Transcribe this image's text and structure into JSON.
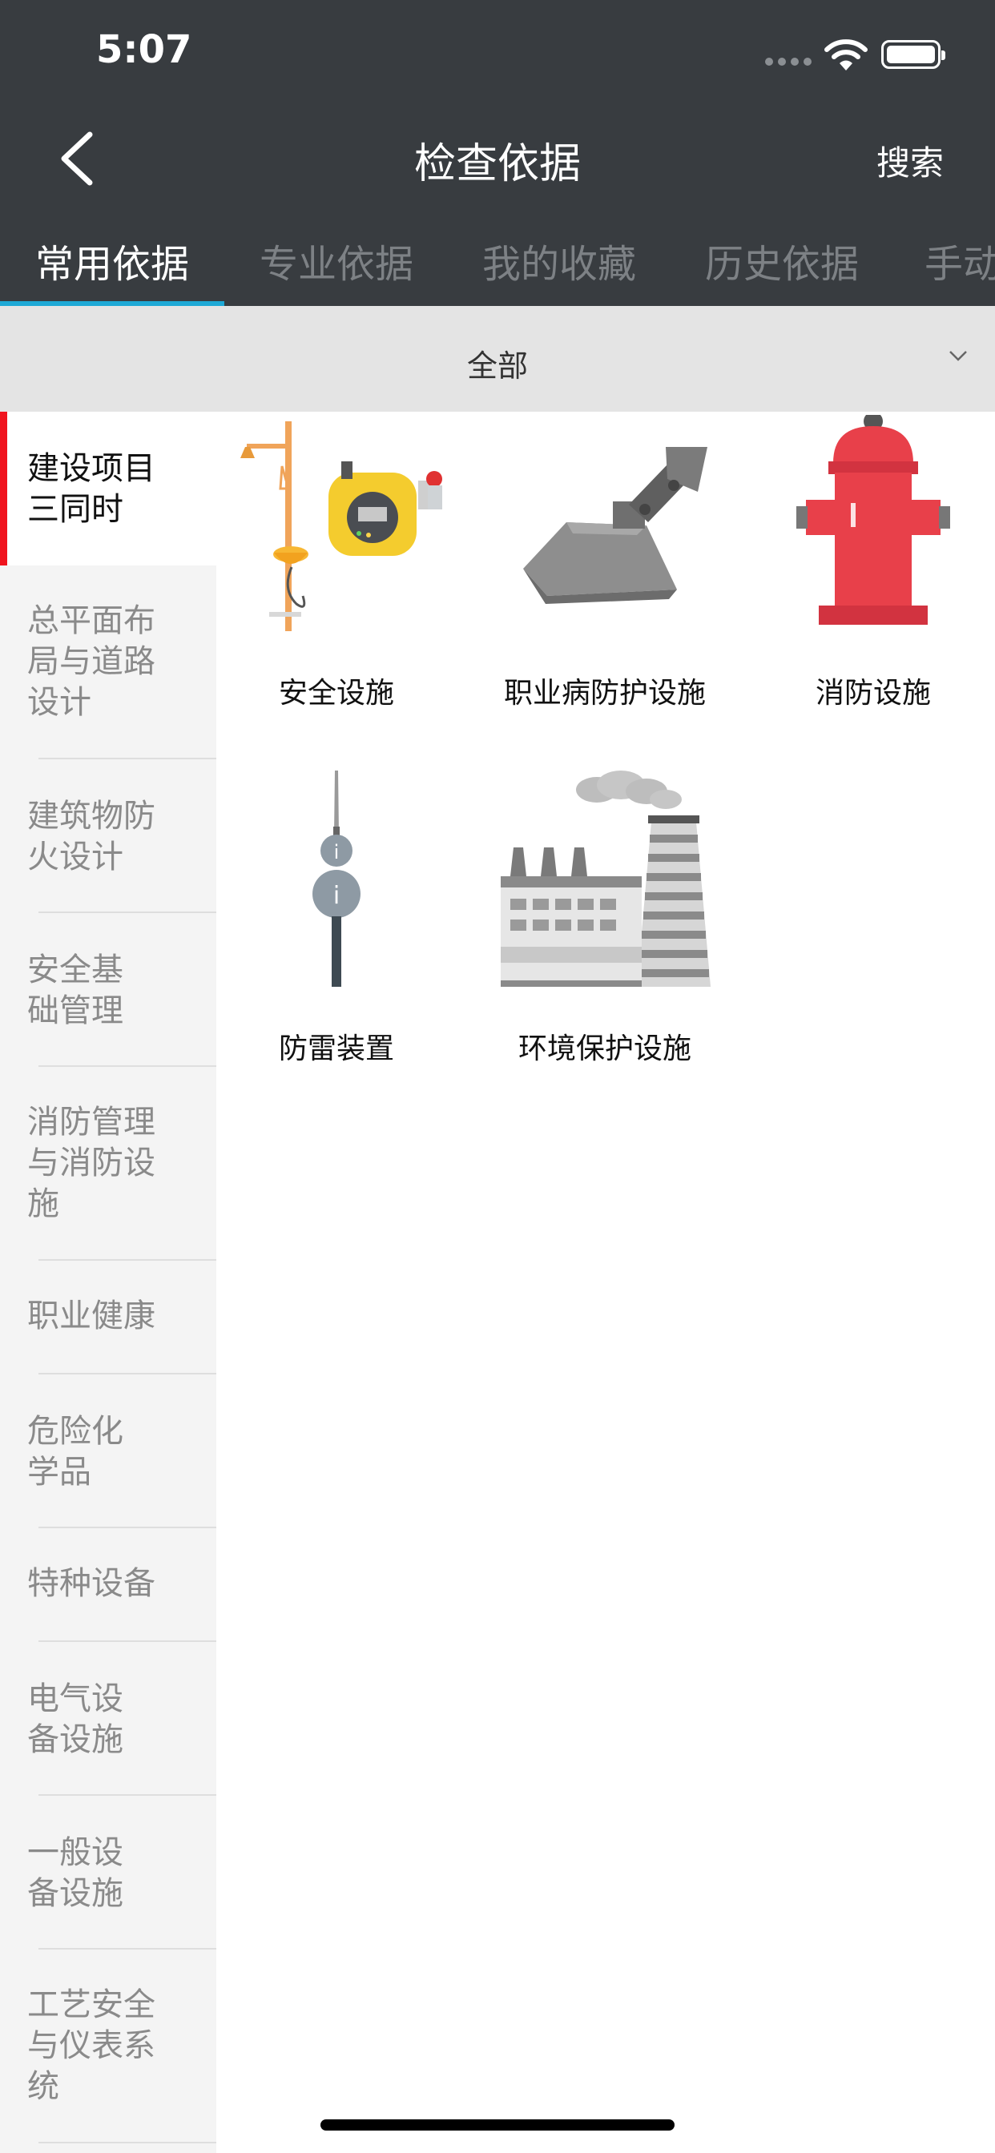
{
  "status_bar": {
    "time": "5:07"
  },
  "nav": {
    "title": "检查依据",
    "search_label": "搜索"
  },
  "tabs": [
    {
      "label": "常用依据",
      "active": true
    },
    {
      "label": "专业依据",
      "active": false
    },
    {
      "label": "我的收藏",
      "active": false
    },
    {
      "label": "历史依据",
      "active": false
    },
    {
      "label": "手动",
      "active": false
    }
  ],
  "filter": {
    "selected": "全部"
  },
  "sidebar": {
    "items": [
      {
        "label": "建设项目\n三同时",
        "active": true
      },
      {
        "label": "总平面布\n局与道路\n设计",
        "active": false
      },
      {
        "label": "建筑物防\n火设计",
        "active": false
      },
      {
        "label": "安全基\n础管理",
        "active": false
      },
      {
        "label": "消防管理\n与消防设\n施",
        "active": false
      },
      {
        "label": "职业健康",
        "active": false
      },
      {
        "label": "危险化\n学品",
        "active": false
      },
      {
        "label": "特种设备",
        "active": false
      },
      {
        "label": "电气设\n备设施",
        "active": false
      },
      {
        "label": "一般设\n备设施",
        "active": false
      },
      {
        "label": "工艺安全\n与仪表系\n统",
        "active": false
      }
    ]
  },
  "grid": [
    {
      "caption": "安全设施",
      "icon": "eyewash-gas-detector-icon"
    },
    {
      "caption": "职业病防护设施",
      "icon": "exhaust-hood-icon"
    },
    {
      "caption": "消防设施",
      "icon": "fire-hydrant-icon"
    },
    {
      "caption": "防雷装置",
      "icon": "lightning-rod-icon"
    },
    {
      "caption": "环境保护设施",
      "icon": "factory-chimney-icon"
    }
  ],
  "colors": {
    "header_bg": "#383c40",
    "tab_indicator": "#1ea9d6",
    "active_marker": "#f0141e",
    "hydrant_red": "#e8404a"
  }
}
